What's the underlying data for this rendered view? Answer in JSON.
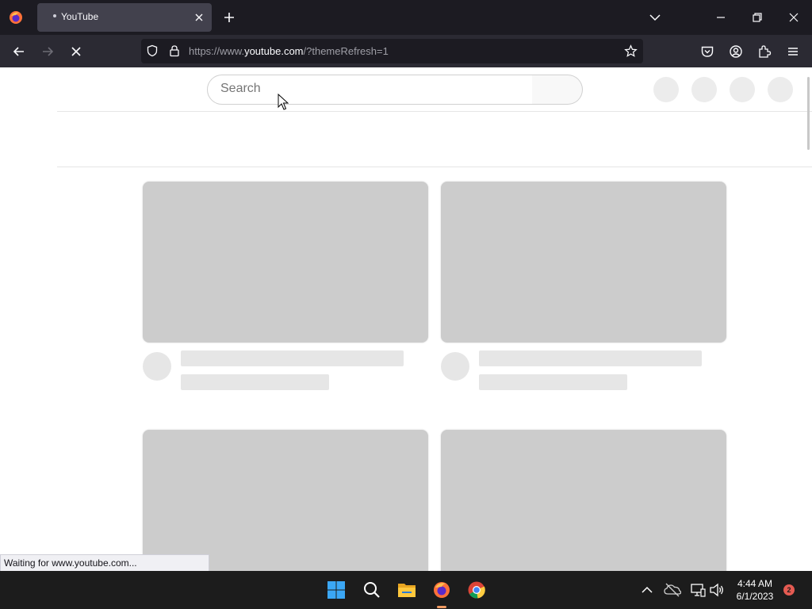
{
  "browser": {
    "tab_title": "YouTube",
    "url_prefix": "https://www.",
    "url_host": "youtube.com",
    "url_suffix": "/?themeRefresh=1"
  },
  "page": {
    "search_placeholder": "Search"
  },
  "status": {
    "text": "Waiting for www.youtube.com..."
  },
  "taskbar": {
    "time": "4:44 AM",
    "date": "6/1/2023",
    "notification_count": "2"
  },
  "icons": {
    "tab_bar": [
      "firefox-logo-icon",
      "close-icon",
      "plus-icon",
      "chevron-down-icon",
      "minimize-icon",
      "restore-icon",
      "close-window-icon"
    ],
    "nav_bar": [
      "back-arrow-icon",
      "forward-arrow-icon",
      "stop-loading-icon",
      "tracking-shield-icon",
      "lock-icon",
      "bookmark-star-icon",
      "pocket-icon",
      "account-icon",
      "extensions-icon",
      "menu-icon"
    ],
    "taskbar": [
      "windows-start-icon",
      "search-icon",
      "file-explorer-icon",
      "firefox-icon",
      "chrome-icon",
      "chevron-up-icon",
      "onedrive-icon",
      "network-icon",
      "volume-icon"
    ]
  },
  "colors": {
    "chrome_dark": "#1c1b22",
    "toolbar": "#2b2a33",
    "active_tab": "#42414d",
    "skeleton_thumb": "#cccccc",
    "skeleton_line": "#e6e6e6",
    "taskbar": "#1c1c1c",
    "notification_badge": "#e55b52"
  }
}
